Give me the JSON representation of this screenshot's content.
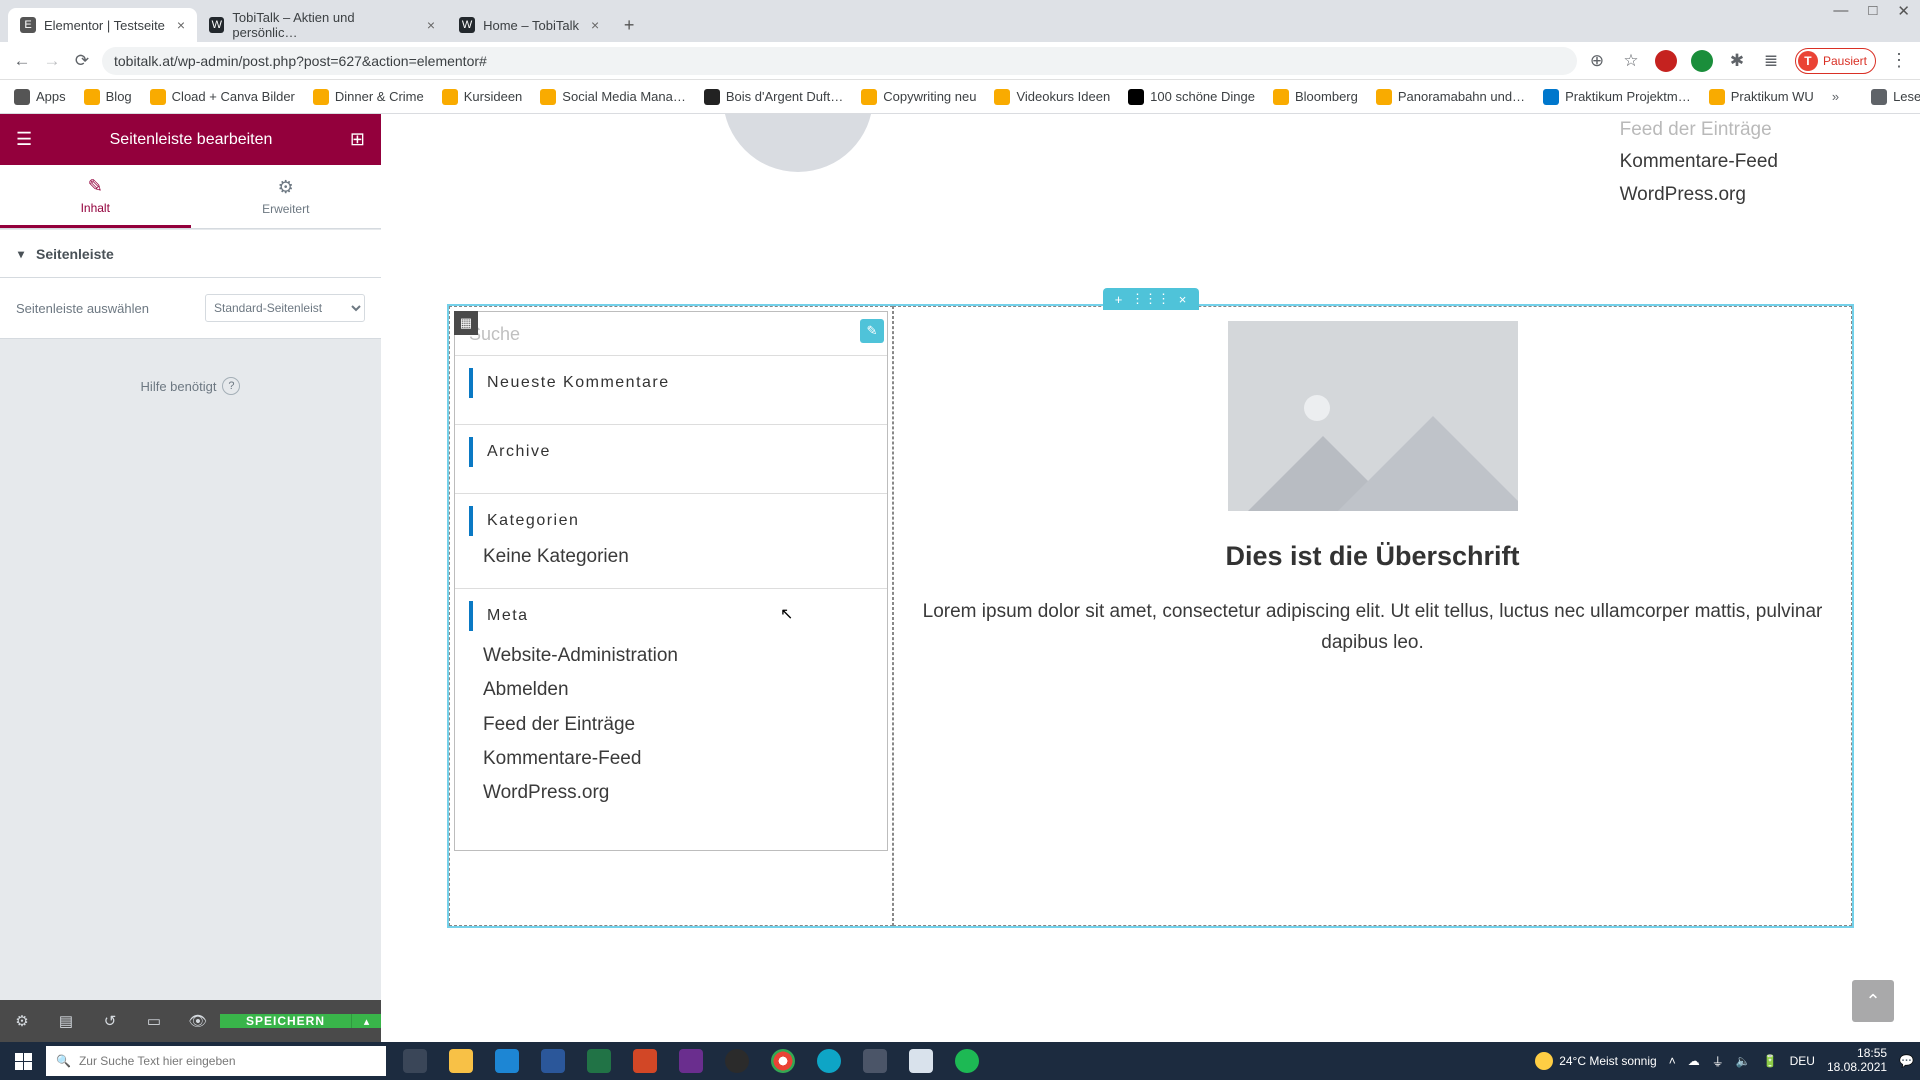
{
  "window": {
    "min": "—",
    "max": "□",
    "close": "✕"
  },
  "tabs": [
    {
      "label": "Elementor | Testseite",
      "active": true
    },
    {
      "label": "TobiTalk – Aktien und persönlic…",
      "active": false
    },
    {
      "label": "Home – TobiTalk",
      "active": false
    }
  ],
  "new_tab": "+",
  "url": "tobitalk.at/wp-admin/post.php?post=627&action=elementor#",
  "profile": {
    "initial": "T",
    "label": "Pausiert"
  },
  "bookmarks": [
    "Apps",
    "Blog",
    "Cload + Canva Bilder",
    "Dinner & Crime",
    "Kursideen",
    "Social Media Mana…",
    "Bois d'Argent Duft…",
    "Copywriting neu",
    "Videokurs Ideen",
    "100 schöne Dinge",
    "Bloomberg",
    "Panoramabahn und…",
    "Praktikum Projektm…",
    "Praktikum WU"
  ],
  "bm_overflow": "»",
  "bm_readlist": "Leseliste",
  "elementor": {
    "header": "Seitenleiste bearbeiten",
    "tab_content": "Inhalt",
    "tab_advanced": "Erweitert",
    "section": "Seitenleiste",
    "control_label": "Seitenleiste auswählen",
    "control_value": "Standard-Seitenleist",
    "help": "Hilfe benötigt",
    "save": "SPEICHERN"
  },
  "canvas": {
    "top_sidebar": [
      "Feed der Einträge",
      "Kommentare-Feed",
      "WordPress.org"
    ],
    "sidebar": {
      "search_ph": "Suche",
      "h_comments": "Neueste Kommentare",
      "h_archive": "Archive",
      "h_cat": "Kategorien",
      "no_cat": "Keine Kategorien",
      "h_meta": "Meta",
      "meta_links": [
        "Website-Administration",
        "Abmelden",
        "Feed der Einträge",
        "Kommentare-Feed",
        "WordPress.org"
      ]
    },
    "main": {
      "heading": "Dies ist die Überschrift",
      "text": "Lorem ipsum dolor sit amet, consectetur adipiscing elit. Ut elit tellus, luctus nec ullamcorper mattis, pulvinar dapibus leo."
    }
  },
  "taskbar": {
    "search_ph": "Zur Suche Text hier eingeben",
    "weather": "24°C  Meist sonnig",
    "lang": "DEU",
    "time": "18:55",
    "date": "18.08.2021"
  }
}
